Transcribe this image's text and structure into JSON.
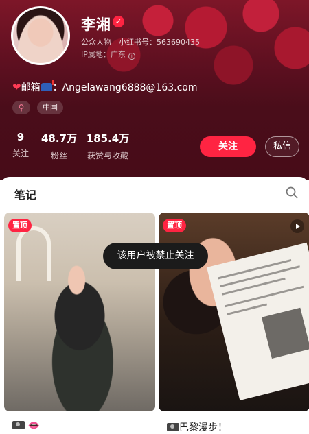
{
  "profile": {
    "name": "李湘",
    "category": "公众人物",
    "account_label": "小红书号：563690435",
    "ip_label": "IP属地：广东",
    "bio_text": "邮箱",
    "bio_email": "：Angelawang6888@163.com",
    "tags": {
      "gender": "♀",
      "location": "中国"
    },
    "stats": [
      {
        "num": "9",
        "label": "关注"
      },
      {
        "num": "48.7万",
        "label": "粉丝"
      },
      {
        "num": "185.4万",
        "label": "获赞与收藏"
      }
    ],
    "follow_label": "关注",
    "message_label": "私信"
  },
  "notes": {
    "title": "笔记",
    "cards": [
      {
        "badge": "置顶",
        "caption": "",
        "has_video": false
      },
      {
        "badge": "置顶",
        "caption": "巴黎漫步！",
        "has_video": true
      }
    ]
  },
  "toast": "该用户被禁止关注",
  "colors": {
    "accent": "#ff2442",
    "header_bg": "#5a0f1f"
  },
  "icons": [
    "verified-icon",
    "info-icon",
    "heart-icon",
    "mailbox-icon",
    "female-icon",
    "search-icon",
    "play-icon",
    "camera-icon",
    "lips-icon"
  ]
}
